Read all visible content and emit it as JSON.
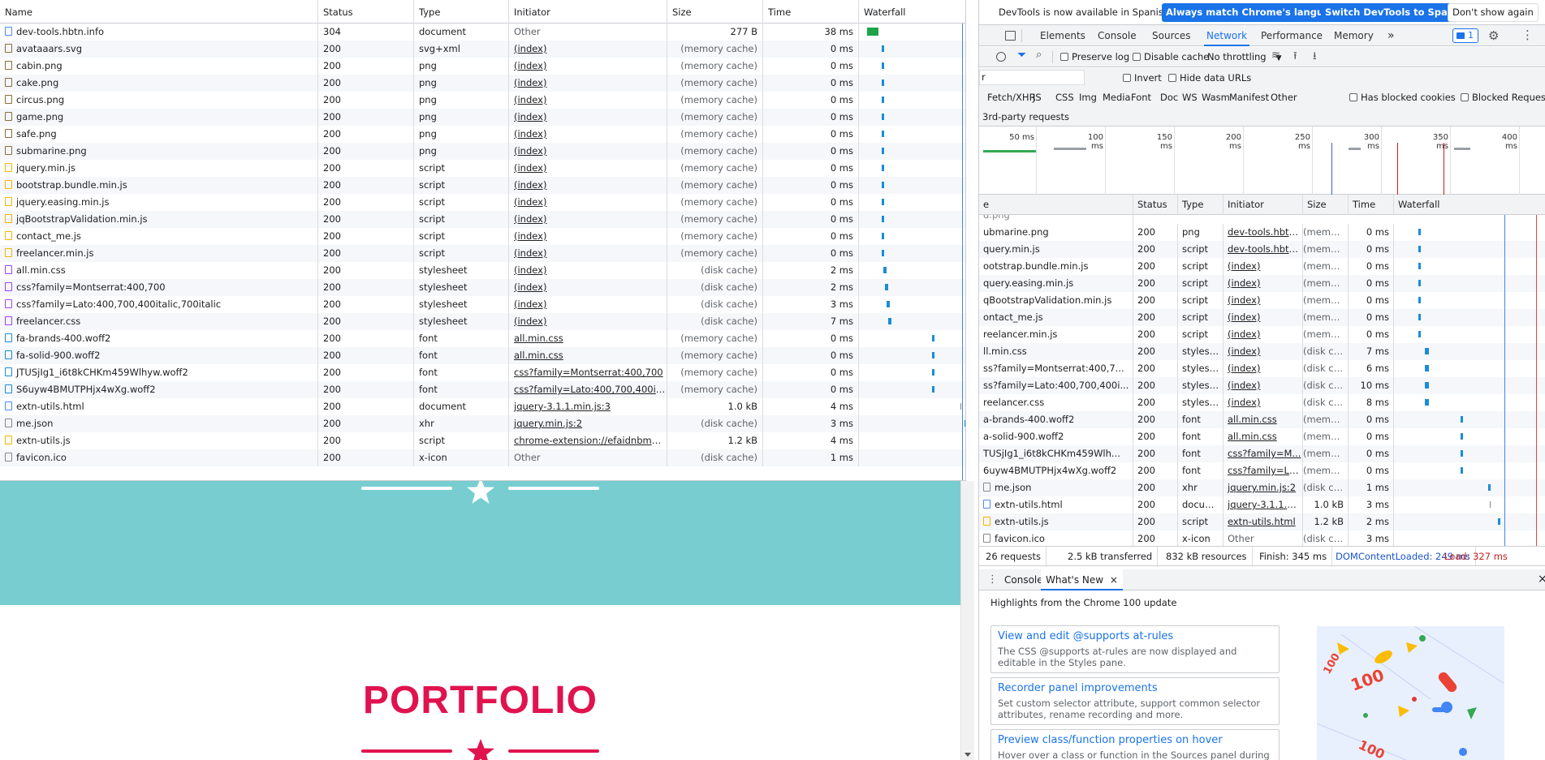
{
  "page": {
    "heading": "PORTFOLIO",
    "colors": {
      "teal": "#78cdd1",
      "accent": "#e0134f"
    }
  },
  "left_table": {
    "columns": [
      "Name",
      "Status",
      "Type",
      "Initiator",
      "Size",
      "Time",
      "Waterfall"
    ],
    "rows": [
      {
        "name": "dev-tools.hbtn.info",
        "status": "304",
        "type": "document",
        "initiator": "Other",
        "size": "277 B",
        "time": "38 ms",
        "icon": "doc"
      },
      {
        "name": "avataaars.svg",
        "status": "200",
        "type": "svg+xml",
        "initiator": "(index)",
        "size": "(memory cache)",
        "time": "0 ms",
        "icon": "img"
      },
      {
        "name": "cabin.png",
        "status": "200",
        "type": "png",
        "initiator": "(index)",
        "size": "(memory cache)",
        "time": "0 ms",
        "icon": "img"
      },
      {
        "name": "cake.png",
        "status": "200",
        "type": "png",
        "initiator": "(index)",
        "size": "(memory cache)",
        "time": "0 ms",
        "icon": "img"
      },
      {
        "name": "circus.png",
        "status": "200",
        "type": "png",
        "initiator": "(index)",
        "size": "(memory cache)",
        "time": "0 ms",
        "icon": "img"
      },
      {
        "name": "game.png",
        "status": "200",
        "type": "png",
        "initiator": "(index)",
        "size": "(memory cache)",
        "time": "0 ms",
        "icon": "img"
      },
      {
        "name": "safe.png",
        "status": "200",
        "type": "png",
        "initiator": "(index)",
        "size": "(memory cache)",
        "time": "0 ms",
        "icon": "img"
      },
      {
        "name": "submarine.png",
        "status": "200",
        "type": "png",
        "initiator": "(index)",
        "size": "(memory cache)",
        "time": "0 ms",
        "icon": "img"
      },
      {
        "name": "jquery.min.js",
        "status": "200",
        "type": "script",
        "initiator": "(index)",
        "size": "(memory cache)",
        "time": "0 ms",
        "icon": "js"
      },
      {
        "name": "bootstrap.bundle.min.js",
        "status": "200",
        "type": "script",
        "initiator": "(index)",
        "size": "(memory cache)",
        "time": "0 ms",
        "icon": "js"
      },
      {
        "name": "jquery.easing.min.js",
        "status": "200",
        "type": "script",
        "initiator": "(index)",
        "size": "(memory cache)",
        "time": "0 ms",
        "icon": "js"
      },
      {
        "name": "jqBootstrapValidation.min.js",
        "status": "200",
        "type": "script",
        "initiator": "(index)",
        "size": "(memory cache)",
        "time": "0 ms",
        "icon": "js"
      },
      {
        "name": "contact_me.js",
        "status": "200",
        "type": "script",
        "initiator": "(index)",
        "size": "(memory cache)",
        "time": "0 ms",
        "icon": "js"
      },
      {
        "name": "freelancer.min.js",
        "status": "200",
        "type": "script",
        "initiator": "(index)",
        "size": "(memory cache)",
        "time": "0 ms",
        "icon": "js"
      },
      {
        "name": "all.min.css",
        "status": "200",
        "type": "stylesheet",
        "initiator": "(index)",
        "size": "(disk cache)",
        "time": "2 ms",
        "icon": "css"
      },
      {
        "name": "css?family=Montserrat:400,700",
        "status": "200",
        "type": "stylesheet",
        "initiator": "(index)",
        "size": "(disk cache)",
        "time": "2 ms",
        "icon": "css"
      },
      {
        "name": "css?family=Lato:400,700,400italic,700italic",
        "status": "200",
        "type": "stylesheet",
        "initiator": "(index)",
        "size": "(disk cache)",
        "time": "3 ms",
        "icon": "css"
      },
      {
        "name": "freelancer.css",
        "status": "200",
        "type": "stylesheet",
        "initiator": "(index)",
        "size": "(disk cache)",
        "time": "7 ms",
        "icon": "css"
      },
      {
        "name": "fa-brands-400.woff2",
        "status": "200",
        "type": "font",
        "initiator": "all.min.css",
        "size": "(memory cache)",
        "time": "0 ms",
        "icon": "font"
      },
      {
        "name": "fa-solid-900.woff2",
        "status": "200",
        "type": "font",
        "initiator": "all.min.css",
        "size": "(memory cache)",
        "time": "0 ms",
        "icon": "font"
      },
      {
        "name": "JTUSjIg1_i6t8kCHKm459Wlhyw.woff2",
        "status": "200",
        "type": "font",
        "initiator": "css?family=Montserrat:400,700",
        "size": "(memory cache)",
        "time": "0 ms",
        "icon": "font"
      },
      {
        "name": "S6uyw4BMUTPHjx4wXg.woff2",
        "status": "200",
        "type": "font",
        "initiator": "css?family=Lato:400,700,400italic,...",
        "size": "(memory cache)",
        "time": "0 ms",
        "icon": "font"
      },
      {
        "name": "extn-utils.html",
        "status": "200",
        "type": "document",
        "initiator": "jquery-3.1.1.min.js:3",
        "size": "1.0 kB",
        "time": "4 ms",
        "icon": "doc"
      },
      {
        "name": "me.json",
        "status": "200",
        "type": "xhr",
        "initiator": "jquery.min.js:2",
        "size": "(disk cache)",
        "time": "3 ms",
        "icon": "blank"
      },
      {
        "name": "extn-utils.js",
        "status": "200",
        "type": "script",
        "initiator": "chrome-extension://efaidnbmnn...",
        "size": "1.2 kB",
        "time": "4 ms",
        "icon": "js"
      },
      {
        "name": "favicon.ico",
        "status": "200",
        "type": "x-icon",
        "initiator": "Other",
        "size": "(disk cache)",
        "time": "1 ms",
        "icon": "blank"
      }
    ]
  },
  "devtools": {
    "infobar": {
      "message": "DevTools is now available in Spanish!",
      "btn_match": "Always match Chrome's language",
      "btn_switch": "Switch DevTools to Spanish",
      "btn_dismiss": "Don't show again"
    },
    "tabs": [
      "Elements",
      "Console",
      "Sources",
      "Network",
      "Performance",
      "Memory"
    ],
    "active_tab": "Network",
    "tabs_more": "»",
    "issues_count": "1",
    "toolbar": {
      "preserve_log": "Preserve log",
      "disable_cache": "Disable cache",
      "throttling": "No throttling"
    },
    "filter": {
      "value": "r",
      "invert": "Invert",
      "hide_data_urls": "Hide data URLs"
    },
    "type_filters": [
      "Fetch/XHR",
      "JS",
      "CSS",
      "Img",
      "Media",
      "Font",
      "Doc",
      "WS",
      "Wasm",
      "Manifest",
      "Other"
    ],
    "has_blocked_cookies": "Has blocked cookies",
    "blocked_requests": "Blocked Requests",
    "third_party": "3rd-party requests",
    "overview_ticks": [
      "50 ms",
      "100 ms",
      "150 ms",
      "200 ms",
      "250 ms",
      "300 ms",
      "350 ms",
      "400 ms"
    ],
    "columns": [
      "e",
      "Status",
      "Type",
      "Initiator",
      "Size",
      "Time",
      "Waterfall"
    ],
    "rows": [
      {
        "name": "ubmarine.png",
        "status": "200",
        "type": "png",
        "initiator": "dev-tools.hbtn...",
        "size": "(memo...",
        "time": "0 ms",
        "icon": "none"
      },
      {
        "name": "query.min.js",
        "status": "200",
        "type": "script",
        "initiator": "dev-tools.hbtn...",
        "size": "(memo...",
        "time": "0 ms",
        "icon": "none"
      },
      {
        "name": "ootstrap.bundle.min.js",
        "status": "200",
        "type": "script",
        "initiator": "(index)",
        "size": "(memo...",
        "time": "0 ms",
        "icon": "none"
      },
      {
        "name": "query.easing.min.js",
        "status": "200",
        "type": "script",
        "initiator": "(index)",
        "size": "(memo...",
        "time": "0 ms",
        "icon": "none"
      },
      {
        "name": "qBootstrapValidation.min.js",
        "status": "200",
        "type": "script",
        "initiator": "(index)",
        "size": "(memo...",
        "time": "0 ms",
        "icon": "none"
      },
      {
        "name": "ontact_me.js",
        "status": "200",
        "type": "script",
        "initiator": "(index)",
        "size": "(memo...",
        "time": "0 ms",
        "icon": "none"
      },
      {
        "name": "reelancer.min.js",
        "status": "200",
        "type": "script",
        "initiator": "(index)",
        "size": "(memo...",
        "time": "0 ms",
        "icon": "none"
      },
      {
        "name": "ll.min.css",
        "status": "200",
        "type": "stylesh...",
        "initiator": "(index)",
        "size": "(disk ca...",
        "time": "7 ms",
        "icon": "none"
      },
      {
        "name": "ss?family=Montserrat:400,7...",
        "status": "200",
        "type": "stylesh...",
        "initiator": "(index)",
        "size": "(disk ca...",
        "time": "6 ms",
        "icon": "none"
      },
      {
        "name": "ss?family=Lato:400,700,400i...",
        "status": "200",
        "type": "stylesh...",
        "initiator": "(index)",
        "size": "(disk ca...",
        "time": "10 ms",
        "icon": "none"
      },
      {
        "name": "reelancer.css",
        "status": "200",
        "type": "stylesh...",
        "initiator": "(index)",
        "size": "(disk ca...",
        "time": "8 ms",
        "icon": "none"
      },
      {
        "name": "a-brands-400.woff2",
        "status": "200",
        "type": "font",
        "initiator": "all.min.css",
        "size": "(memo...",
        "time": "0 ms",
        "icon": "none"
      },
      {
        "name": "a-solid-900.woff2",
        "status": "200",
        "type": "font",
        "initiator": "all.min.css",
        "size": "(memo...",
        "time": "0 ms",
        "icon": "none"
      },
      {
        "name": "TUSjIg1_i6t8kCHKm459Wlh...",
        "status": "200",
        "type": "font",
        "initiator": "css?family=M...",
        "size": "(memo...",
        "time": "0 ms",
        "icon": "none"
      },
      {
        "name": "6uyw4BMUTPHjx4wXg.woff2",
        "status": "200",
        "type": "font",
        "initiator": "css?family=Lat...",
        "size": "(memo...",
        "time": "0 ms",
        "icon": "none"
      },
      {
        "name": "me.json",
        "status": "200",
        "type": "xhr",
        "initiator": "jquery.min.js:2",
        "size": "(disk ca...",
        "time": "1 ms",
        "icon": "blank"
      },
      {
        "name": "extn-utils.html",
        "status": "200",
        "type": "docum...",
        "initiator": "jquery-3.1.1.m...",
        "size": "1.0 kB",
        "time": "3 ms",
        "icon": "doc"
      },
      {
        "name": "extn-utils.js",
        "status": "200",
        "type": "script",
        "initiator": "extn-utils.html",
        "size": "1.2 kB",
        "time": "2 ms",
        "icon": "js"
      },
      {
        "name": "favicon.ico",
        "status": "200",
        "type": "x-icon",
        "initiator": "Other",
        "size": "(disk ca...",
        "time": "3 ms",
        "icon": "blank"
      }
    ],
    "status_bar": {
      "requests": "26 requests",
      "transferred": "2.5 kB transferred",
      "resources": "832 kB resources",
      "finish": "Finish: 345 ms",
      "dcl": "DOMContentLoaded: 249 ms",
      "load": "Load: 327 ms"
    },
    "drawer": {
      "tab_console": "Console",
      "tab_whats_new": "What's New",
      "close": "×",
      "headline": "Highlights from the Chrome 100 update",
      "cards": [
        {
          "title": "View and edit @supports at-rules",
          "desc": "The CSS @supports at-rules are now displayed and editable in the Styles pane."
        },
        {
          "title": "Recorder panel improvements",
          "desc": "Set custom selector attribute, support common selector attributes, rename recording and more."
        },
        {
          "title": "Preview class/function properties on hover",
          "desc": "Hover over a class or function in the Sources panel during"
        }
      ]
    }
  }
}
